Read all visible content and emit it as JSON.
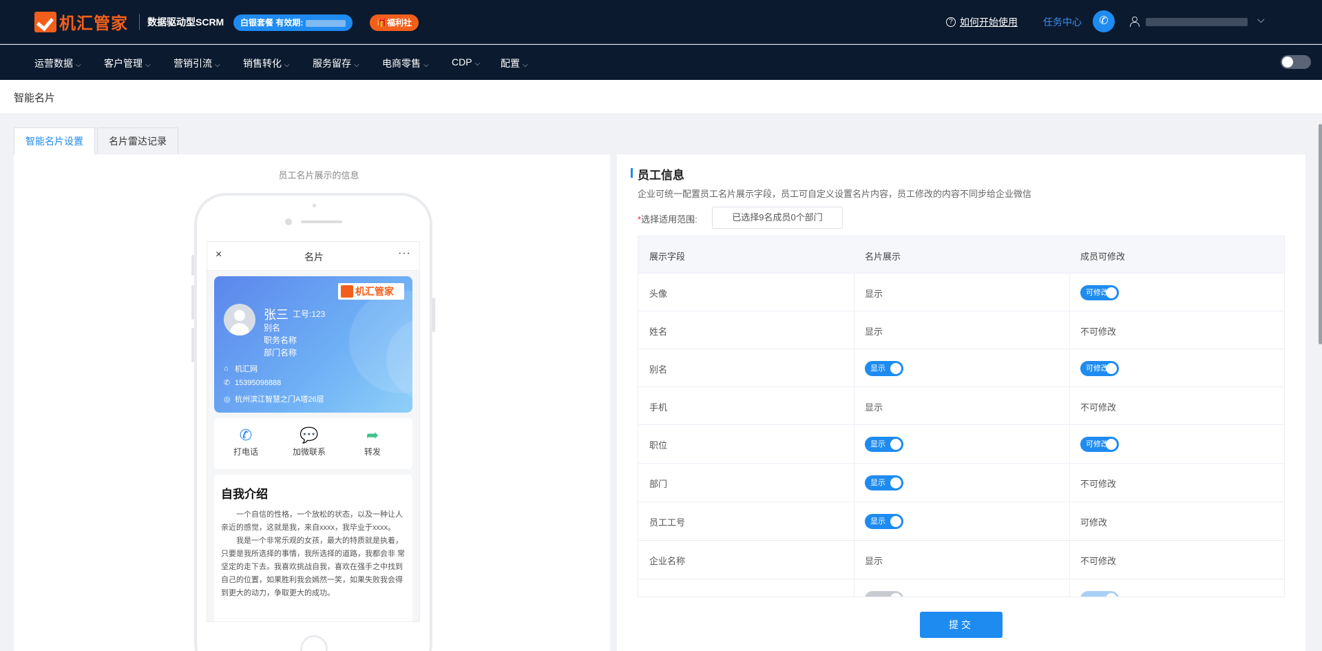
{
  "header": {
    "logo_text": "机汇管家",
    "slogan": "数据驱动型SCRM",
    "plan_label": "白银套餐 有效期:",
    "welfare_label": "福利社",
    "help_label": "如何开始使用",
    "task_center_label": "任务中心"
  },
  "nav": {
    "items": [
      {
        "label": "运营数据"
      },
      {
        "label": "客户管理"
      },
      {
        "label": "营销引流"
      },
      {
        "label": "销售转化"
      },
      {
        "label": "服务留存"
      },
      {
        "label": "电商零售"
      },
      {
        "label": "CDP"
      },
      {
        "label": "配置"
      }
    ]
  },
  "page": {
    "title": "智能名片",
    "tabs": [
      {
        "label": "智能名片设置",
        "active": true
      },
      {
        "label": "名片雷达记录",
        "active": false
      }
    ]
  },
  "preview": {
    "caption": "员工名片展示的信息",
    "screen_title": "名片",
    "close_icon": "×",
    "more_icon": "···",
    "card": {
      "logo_text": "机汇管家",
      "name": "张三",
      "emp_no": "工号:123",
      "alias": "别名",
      "position": "职务名称",
      "department": "部门名称",
      "website": "机汇网",
      "phone": "15395098888",
      "address": "杭州滨江智慧之门A塔26层"
    },
    "actions": [
      {
        "label": "打电话",
        "icon": "phone-icon"
      },
      {
        "label": "加微联系",
        "icon": "wechat-icon"
      },
      {
        "label": "转发",
        "icon": "share-icon"
      }
    ],
    "intro": {
      "title": "自我介绍",
      "p1": "一个自信的性格，一个放松的状态，以及一种让人亲近的感觉，这就是我，来自xxxx，我毕业于xxxx。",
      "p2": "我是一个非常乐观的女孩，最大的特质就是执着，只要是我所选择的事情，我所选择的道路，我都会非 常坚定的走下去。我喜欢挑战自我，喜欢在强手之中找到自己的位置，如果胜利我会嫣然一笑，如果失败我会得到更大的动力，争取更大的成功。"
    }
  },
  "settings": {
    "title": "员工信息",
    "description": "企业可统一配置员工名片展示字段，员工可自定义设置名片内容，员工修改的内容不同步给企业微信",
    "scope_required": "*",
    "scope_label": "选择适用范围:",
    "scope_value": "已选择9名成员0个部门",
    "columns": [
      "展示字段",
      "名片展示",
      "成员可修改"
    ],
    "rows": [
      {
        "field": "头像",
        "display": "显示",
        "display_toggle": false,
        "editable": "可修改",
        "editable_toggle": true
      },
      {
        "field": "姓名",
        "display": "显示",
        "display_toggle": false,
        "editable": "不可修改",
        "editable_toggle": false
      },
      {
        "field": "别名",
        "display": "显示",
        "display_toggle": true,
        "editable": "可修改",
        "editable_toggle": true
      },
      {
        "field": "手机",
        "display": "显示",
        "display_toggle": false,
        "editable": "不可修改",
        "editable_toggle": false
      },
      {
        "field": "职位",
        "display": "显示",
        "display_toggle": true,
        "editable": "可修改",
        "editable_toggle": true
      },
      {
        "field": "部门",
        "display": "显示",
        "display_toggle": true,
        "editable": "不可修改",
        "editable_toggle": false
      },
      {
        "field": "员工工号",
        "display": "显示",
        "display_toggle": true,
        "editable": "可修改",
        "editable_toggle": false
      },
      {
        "field": "企业名称",
        "display": "显示",
        "display_toggle": false,
        "editable": "不可修改",
        "editable_toggle": false
      }
    ],
    "submit_label": "提交"
  }
}
